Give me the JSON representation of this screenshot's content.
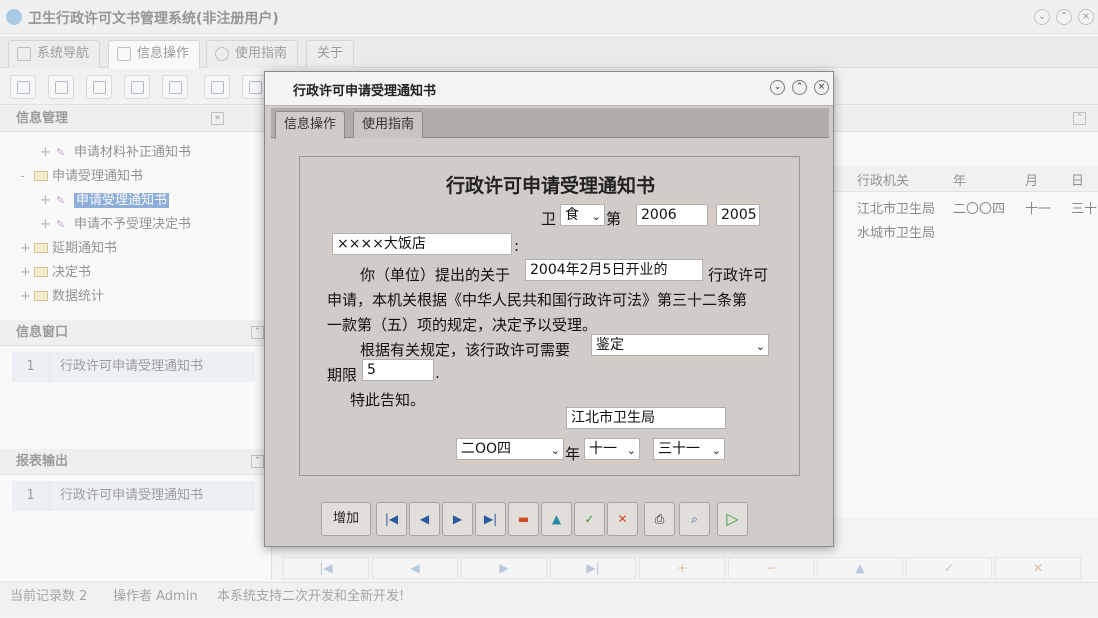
{
  "app": {
    "title": "卫生行政许可文书管理系统(非注册用户)"
  },
  "main_tabs": [
    "系统导航",
    "信息操作",
    "使用指南",
    "关于"
  ],
  "left_panel": {
    "header": "信息管理",
    "tree": [
      {
        "label": "申请材料补正通知书",
        "level": 2,
        "type": "leaf"
      },
      {
        "label": "申请受理通知书",
        "level": 1,
        "type": "folder"
      },
      {
        "label": "申请受理通知书",
        "level": 2,
        "type": "leaf",
        "selected": true
      },
      {
        "label": "申请不予受理决定书",
        "level": 2,
        "type": "leaf"
      },
      {
        "label": "延期通知书",
        "level": 1,
        "type": "folder"
      },
      {
        "label": "决定书",
        "level": 1,
        "type": "folder"
      },
      {
        "label": "数据统计",
        "level": 1,
        "type": "folder"
      }
    ],
    "info_window": {
      "header": "信息窗口",
      "rows": [
        {
          "n": "1",
          "label": "行政许可申请受理通知书"
        }
      ]
    },
    "report": {
      "header": "报表输出",
      "rows": [
        {
          "n": "1",
          "label": "行政许可申请受理通知书"
        }
      ]
    }
  },
  "grid": {
    "columns": [
      "行政机关",
      "年",
      "月",
      "日"
    ],
    "rows": [
      {
        "org": "江北市卫生局",
        "year": "二〇〇四",
        "month": "十一",
        "day": "三十"
      },
      {
        "org": "水城市卫生局",
        "year": "",
        "month": "",
        "day": ""
      }
    ]
  },
  "statusbar": {
    "records": "当前记录数 2",
    "operator": "操作者 Admin",
    "note": "本系统支持二次开发和全新开发!"
  },
  "dialog": {
    "title": "行政许可申请受理通知书",
    "tabs": [
      "信息操作",
      "使用指南"
    ],
    "form": {
      "heading": "行政许可申请受理通知书",
      "prefix_wei": "卫",
      "category": "食",
      "di_label": "第",
      "year_code": "2006",
      "number": "2005",
      "applicant": "××××大饭店",
      "colon": ":",
      "line1_pre": "你（单位）提出的关于",
      "subject": "2004年2月5日开业的",
      "line1_post": "行政许可",
      "line2": "申请，本机关根据《中华人民共和国行政许可法》第三十二条第",
      "line3": "一款第（五）项的规定，决定予以受理。",
      "line4_pre": "根据有关规定，该行政许可需要",
      "requirement": "鉴定",
      "period_label": "期限",
      "period": "5",
      "period_dot": ".",
      "notice": "特此告知。",
      "authority": "江北市卫生局",
      "date_year": "二OO四",
      "year_label": "年",
      "date_month": "十一",
      "date_day": "三十一"
    },
    "toolbar": {
      "add_label": "增加"
    }
  }
}
